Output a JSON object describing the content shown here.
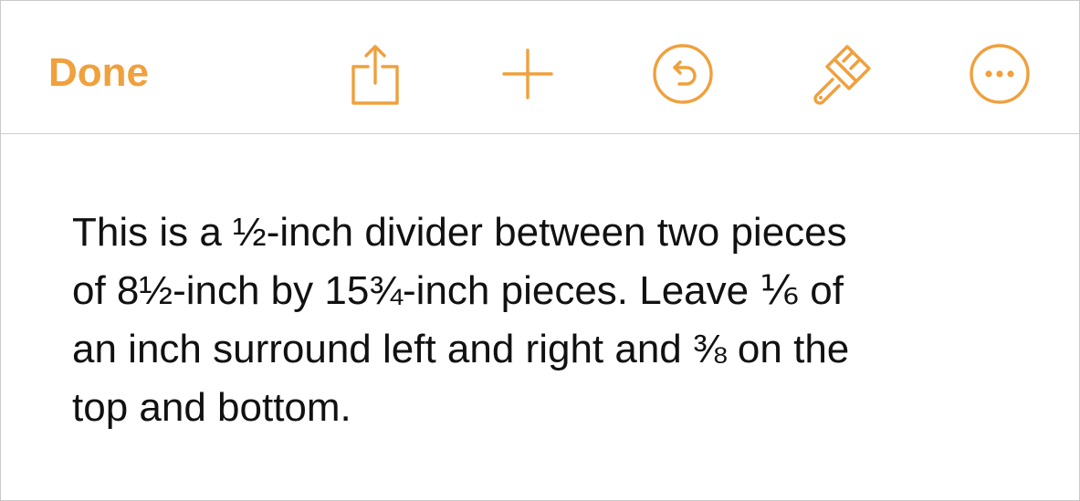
{
  "toolbar": {
    "done_label": "Done",
    "icons": [
      "share-icon",
      "plus-icon",
      "undo-icon",
      "paintbrush-icon",
      "more-icon"
    ],
    "accent_color": "#f0a03c"
  },
  "document": {
    "text": "This is a ½-inch divider between two pieces\nof 8½-inch by 15¾-inch pieces. Leave ⅙ of\nan inch surround left and right and ⅜ on the\ntop and bottom."
  }
}
